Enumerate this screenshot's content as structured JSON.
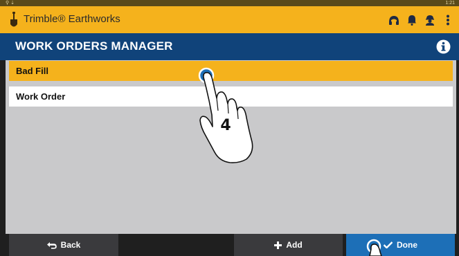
{
  "status_bar": {
    "left_icons": "⚲ ⇣",
    "time": "1:21"
  },
  "app": {
    "name": "Trimble® Earthworks",
    "icons": [
      "headset-icon",
      "bell-icon",
      "user-icon",
      "more-vert-icon"
    ]
  },
  "page": {
    "title": "WORK ORDERS MANAGER"
  },
  "list": {
    "items": [
      {
        "label": "Bad Fill",
        "selected": true
      },
      {
        "label": "Work Order",
        "selected": false
      }
    ]
  },
  "step": {
    "number": "4"
  },
  "buttons": {
    "back": "Back",
    "add": "Add",
    "done": "Done"
  },
  "colors": {
    "accent": "#f5b21c",
    "header": "#10437a",
    "primary_button": "#1d6fb7",
    "dark_button": "#3a3a3d",
    "background": "#c9c9cb"
  }
}
